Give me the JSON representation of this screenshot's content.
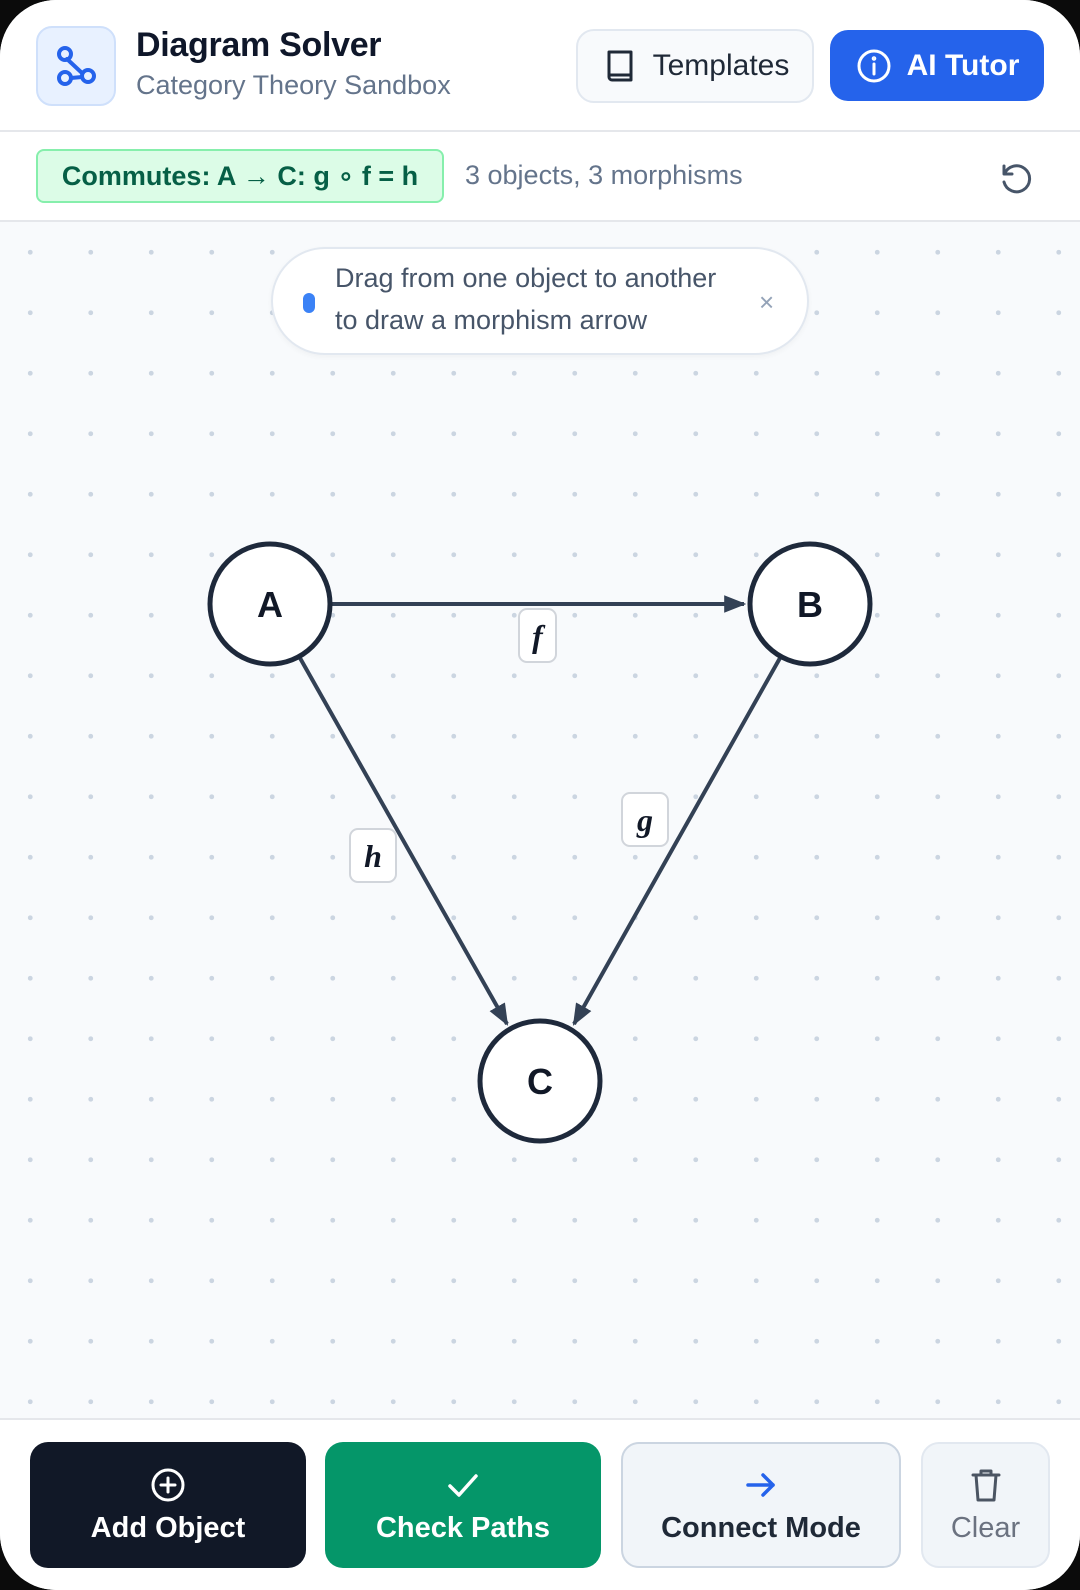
{
  "header": {
    "title": "Diagram Solver",
    "subtitle": "Category Theory Sandbox",
    "templates_label": "Templates",
    "tutor_label": "AI Tutor",
    "logo_icon": "graph-nodes-icon",
    "templates_icon": "book-icon",
    "tutor_icon": "info-icon"
  },
  "status": {
    "badge": "Commutes: A → C: g ∘ f = h",
    "counts": "3 objects, 3 morphisms",
    "undo_icon": "undo-icon"
  },
  "hint": {
    "line1": "Drag from one object to another",
    "line2": "to draw a morphism arrow",
    "close": "×"
  },
  "diagram": {
    "objects": [
      {
        "id": "A",
        "label": "A"
      },
      {
        "id": "B",
        "label": "B"
      },
      {
        "id": "C",
        "label": "C"
      }
    ],
    "morphisms": [
      {
        "label": "f",
        "from": "A",
        "to": "B"
      },
      {
        "label": "g",
        "from": "B",
        "to": "C"
      },
      {
        "label": "h",
        "from": "A",
        "to": "C"
      }
    ]
  },
  "toolbar": {
    "add_label": "Add Object",
    "check_label": "Check Paths",
    "connect_label": "Connect Mode",
    "clear_label": "Clear",
    "add_icon": "plus-circle-icon",
    "check_icon": "checkmark-icon",
    "connect_icon": "arrow-right-icon",
    "clear_icon": "trash-icon"
  },
  "colors": {
    "accent": "#2563eb",
    "success": "#059669",
    "dark": "#111827",
    "badge_bg": "#dcfce7",
    "badge_text": "#065f46"
  }
}
